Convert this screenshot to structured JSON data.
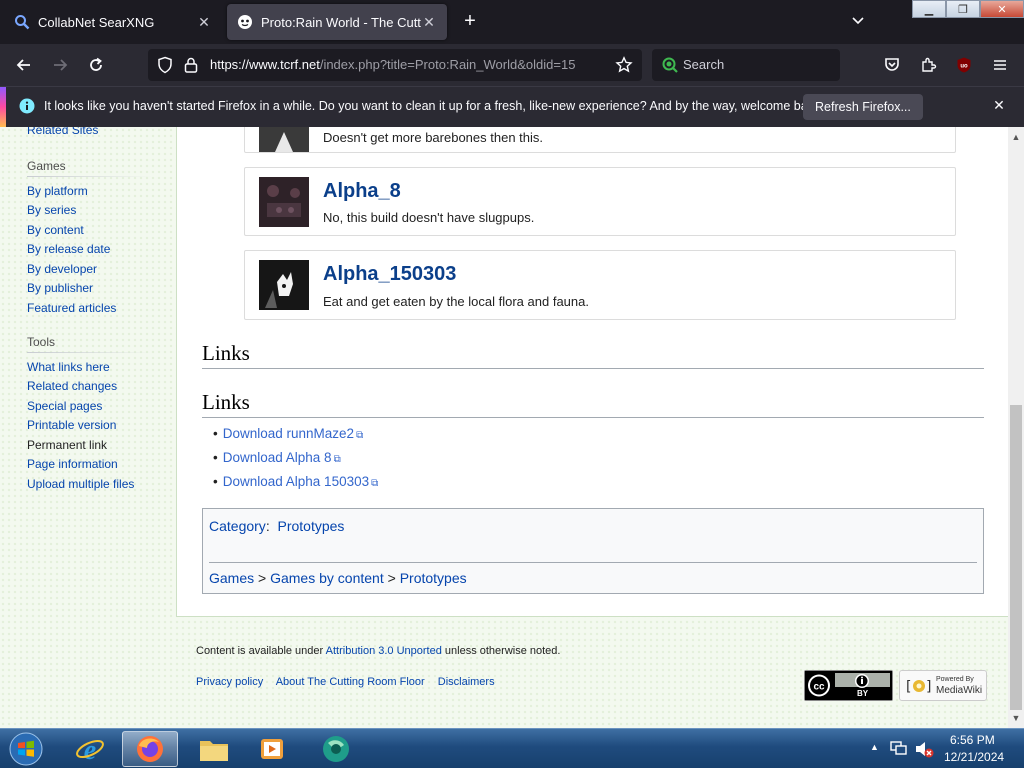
{
  "browser": {
    "tabs": [
      {
        "title": "CollabNet SearXNG",
        "active": false
      },
      {
        "title": "Proto:Rain World - The Cutting",
        "active": true
      }
    ],
    "url_host": "https://www.tcrf.net",
    "url_rest": "/index.php?title=Proto:Rain_World&oldid=15",
    "search_placeholder": "Search",
    "notification": {
      "message": "It looks like you haven't started Firefox in a while. Do you want to clean it up for a fresh, like-new experience? And by the way, welcome back!",
      "button": "Refresh Firefox..."
    }
  },
  "sidebar": {
    "partial_item": "Related Sites",
    "games_heading": "Games",
    "games_items": [
      "By platform",
      "By series",
      "By content",
      "By release date",
      "By developer",
      "By publisher",
      "Featured articles"
    ],
    "tools_heading": "Tools",
    "tools_items": [
      "What links here",
      "Related changes",
      "Special pages",
      "Printable version",
      "Permanent link",
      "Page information",
      "Upload multiple files"
    ]
  },
  "cards": [
    {
      "title": "",
      "description": "Doesn't get more barebones then this."
    },
    {
      "title": "Alpha_8",
      "description": "No, this build doesn't have slugpups."
    },
    {
      "title": "Alpha_150303",
      "description": "Eat and get eaten by the local flora and fauna."
    }
  ],
  "sections": {
    "heading1": "Links",
    "heading2": "Links",
    "downloads": [
      "Download runnMaze2",
      "Download Alpha 8",
      "Download Alpha 150303"
    ]
  },
  "categories": {
    "label": "Category",
    "separator": ":",
    "value": "Prototypes",
    "breadcrumb": [
      "Games",
      "Games by content",
      "Prototypes"
    ],
    "breadcrumb_sep": ">"
  },
  "footer": {
    "license_pre": "Content is available under",
    "license_link": "Attribution 3.0 Unported",
    "license_post": "unless otherwise noted.",
    "links": [
      "Privacy policy",
      "About The Cutting Room Floor",
      "Disclaimers"
    ],
    "mw_powered": "Powered By",
    "mw_name": "MediaWiki",
    "cc_by": "BY"
  },
  "taskbar": {
    "time": "6:56 PM",
    "date": "12/21/2024"
  },
  "colors": {
    "link": "#0645ad",
    "card_title": "#0b3f8a",
    "browser_bg": "#1c1b22",
    "toolbar_bg": "#2b2a33"
  }
}
